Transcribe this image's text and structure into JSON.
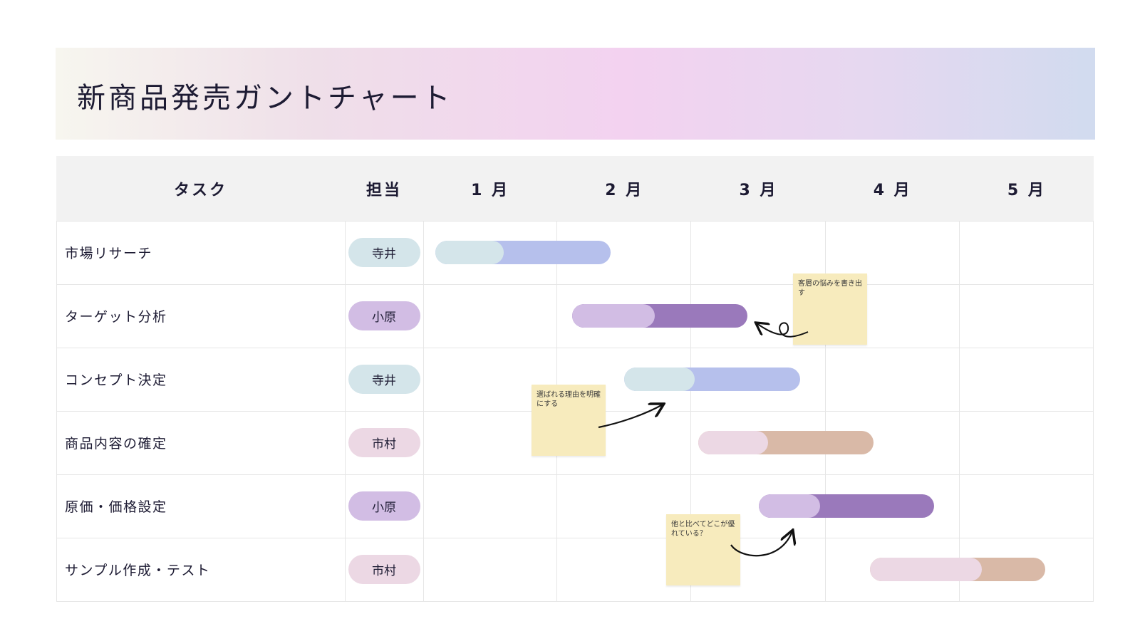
{
  "title": "新商品発売ガントチャート",
  "colors": {
    "teal": "#d4e5ea",
    "blue": "#b6c0ec",
    "lavender": "#d2bde4",
    "purple": "#9a79bb",
    "pink": "#ecd8e4",
    "tan": "#d9b9a7",
    "note": "#f7ebbd"
  },
  "chart_data": {
    "type": "gantt",
    "columns": {
      "task": "タスク",
      "owner": "担当"
    },
    "months": [
      "1 月",
      "2 月",
      "3 月",
      "4 月",
      "5 月"
    ],
    "tasks": [
      {
        "name": "市場リサーチ",
        "owner": "寺井",
        "owner_color": "#d4e5ea",
        "start": 0.09,
        "end": 1.4,
        "progress": 0.39,
        "done_color": "#d4e5ea",
        "rest_color": "#b6c0ec"
      },
      {
        "name": "ターゲット分析",
        "owner": "小原",
        "owner_color": "#d2bde4",
        "start": 1.11,
        "end": 2.42,
        "progress": 0.47,
        "done_color": "#d2bde4",
        "rest_color": "#9a79bb"
      },
      {
        "name": "コンセプト決定",
        "owner": "寺井",
        "owner_color": "#d4e5ea",
        "start": 1.5,
        "end": 2.81,
        "progress": 0.4,
        "done_color": "#d4e5ea",
        "rest_color": "#b6c0ec"
      },
      {
        "name": "商品内容の確定",
        "owner": "市村",
        "owner_color": "#ecd8e4",
        "start": 2.05,
        "end": 3.36,
        "progress": 0.4,
        "done_color": "#ecd8e4",
        "rest_color": "#d9b9a7"
      },
      {
        "name": "原価・価格設定",
        "owner": "小原",
        "owner_color": "#d2bde4",
        "start": 2.5,
        "end": 3.81,
        "progress": 0.35,
        "done_color": "#d2bde4",
        "rest_color": "#9a79bb"
      },
      {
        "name": "サンプル作成・テスト",
        "owner": "市村",
        "owner_color": "#ecd8e4",
        "start": 3.33,
        "end": 4.64,
        "progress": 0.64,
        "done_color": "#ecd8e4",
        "rest_color": "#d9b9a7"
      }
    ]
  },
  "notes": [
    {
      "text": "客層の悩みを書き出す"
    },
    {
      "text": "選ばれる理由を明確にする"
    },
    {
      "text": "他と比べてどこが優れている？"
    }
  ]
}
